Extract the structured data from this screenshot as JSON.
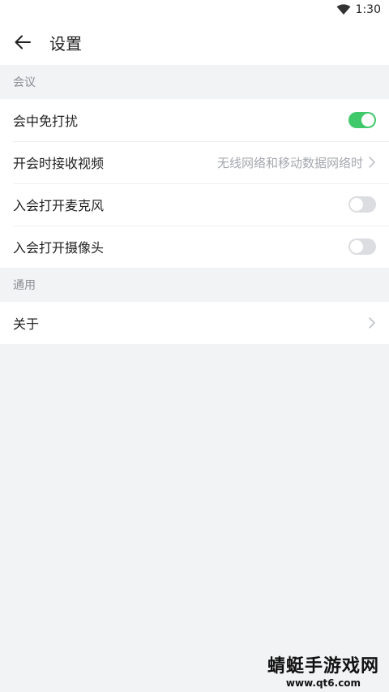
{
  "status_bar": {
    "time": "1:30",
    "wifi_icon": "wifi-icon"
  },
  "header": {
    "title": "设置",
    "back_icon": "arrow-left-icon"
  },
  "sections": [
    {
      "title": "会议",
      "items": [
        {
          "label": "会中免打扰",
          "type": "toggle",
          "on": true
        },
        {
          "label": "开会时接收视频",
          "type": "value",
          "value": "无线网络和移动数据网络时"
        },
        {
          "label": "入会打开麦克风",
          "type": "toggle",
          "on": false
        },
        {
          "label": "入会打开摄像头",
          "type": "toggle",
          "on": false
        }
      ]
    },
    {
      "title": "通用",
      "items": [
        {
          "label": "关于",
          "type": "link"
        }
      ]
    }
  ],
  "colors": {
    "toggle_on": "#3fc96b",
    "toggle_off": "#dcdde0",
    "background": "#f2f3f5"
  },
  "watermark": {
    "text": "蜻蜓手游戏网",
    "url": "www.qt6.com"
  }
}
